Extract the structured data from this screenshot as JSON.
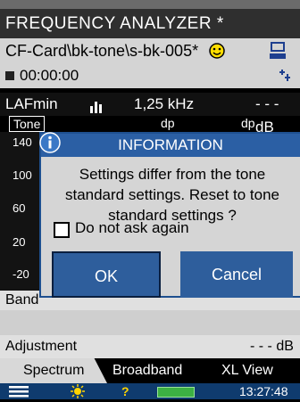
{
  "window": {
    "title": "FREQUENCY ANALYZER *"
  },
  "path": {
    "text": "CF-Card\\bk-tone\\s-bk-005*",
    "status_icon": "smiley-icon",
    "save_icon": "storage-icon"
  },
  "timer": {
    "value": "00:00:00"
  },
  "measurement": {
    "parameter": "LAFmin",
    "freq": "1,25 kHz",
    "unit": "- - - dB"
  },
  "tone_label": "Tone",
  "tone_values": [
    "dp",
    "dp"
  ],
  "axis": {
    "ticks": [
      "140",
      "100",
      "60",
      "20",
      "-20"
    ]
  },
  "band_label": "Band",
  "adjustment": {
    "label": "Adjustment",
    "value": "- - - dB"
  },
  "tabs": [
    "Spectrum",
    "Broadband",
    "XL View"
  ],
  "status": {
    "time": "13:27:48"
  },
  "dialog": {
    "title": "INFORMATION",
    "icon": "info-icon",
    "message_lines": [
      "Settings differ from the tone",
      "standard settings. Reset to tone",
      "standard settings ?"
    ],
    "checkbox_label": "Do not ask again",
    "ok_label": "OK",
    "cancel_label": "Cancel"
  },
  "colors": {
    "titlebar": "#2f2f2f",
    "dialog_accent": "#2b5fa4",
    "status_bar": "#0f3b6e",
    "battery": "#3cb043"
  }
}
